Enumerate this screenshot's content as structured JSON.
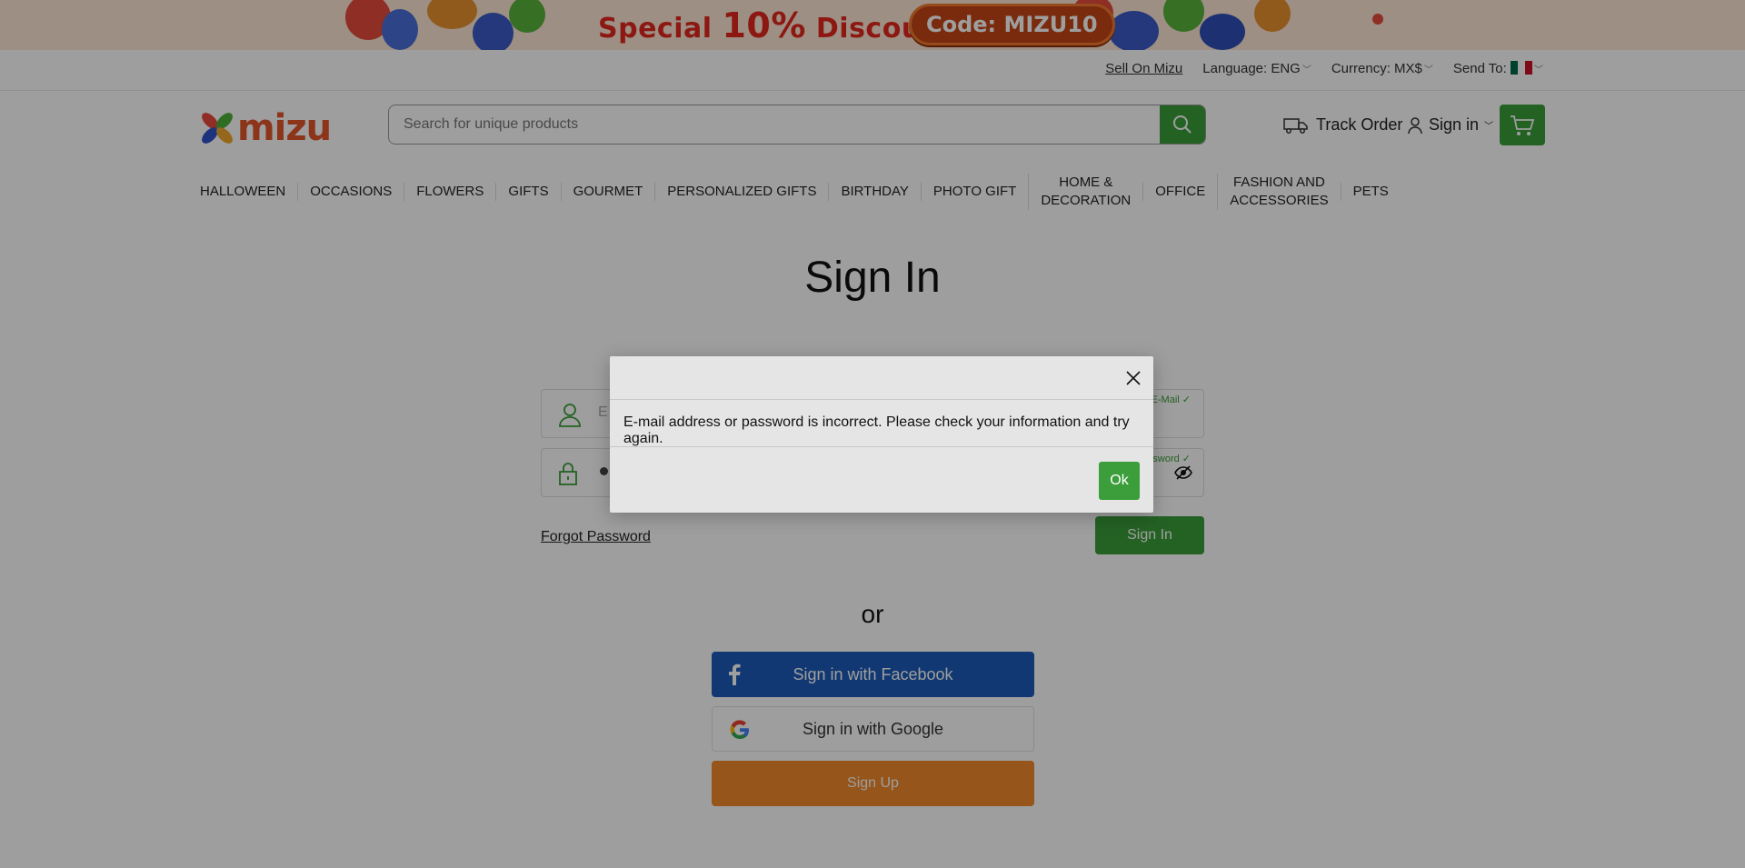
{
  "promo": {
    "text_pre": "Special ",
    "text_num": "10%",
    "text_post": " Discount",
    "code": "Code: MIZU10"
  },
  "util": {
    "sell": "Sell On Mizu",
    "language": "Language: ENG",
    "currency": "Currency: MX$",
    "send_to": "Send To:"
  },
  "header": {
    "logo": "mizu",
    "search_placeholder": "Search for unique products",
    "track_order": "Track Order",
    "sign_in": "Sign in"
  },
  "nav": [
    "HALLOWEEN",
    "OCCASIONS",
    "FLOWERS",
    "GIFTS",
    "GOURMET",
    "PERSONALIZED GIFTS",
    "BIRTHDAY",
    "PHOTO GIFT",
    "HOME &\nDECORATION",
    "OFFICE",
    "FASHION AND\nACCESSORIES",
    "PETS"
  ],
  "page": {
    "title": "Sign In",
    "email_label": "E-Mail",
    "email_placeholder": "E",
    "password_label": "Password",
    "password_dots": 10,
    "forgot": "Forgot Password",
    "signin_btn": "Sign In",
    "or": "or",
    "facebook": "Sign in with Facebook",
    "google": "Sign in with Google",
    "signup": "Sign Up"
  },
  "modal": {
    "message": "E-mail address or password is incorrect. Please check your information and try again.",
    "ok": "Ok"
  },
  "colors": {
    "accent": "#3b9e3a",
    "facebook": "#1c5bb8",
    "signup": "#f08a2c",
    "logo": "#e2562b"
  }
}
